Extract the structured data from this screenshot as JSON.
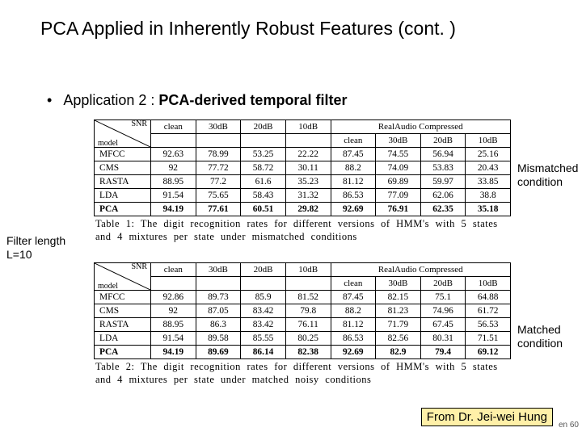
{
  "title": "PCA Applied in Inherently Robust Features (cont. )",
  "bullet": {
    "plain": "Application 2 : ",
    "bold": "PCA-derived temporal filter"
  },
  "annotations": {
    "mismatched": "Mismatched condition",
    "matched": "Matched condition",
    "filterLength": "Filter length L=10"
  },
  "tableHeader": {
    "diagTop": "SNR",
    "diagBottom": "model",
    "group2": "RealAudio Compressed",
    "snrs1": [
      "clean",
      "30dB",
      "20dB",
      "10dB"
    ],
    "snrs2": [
      "clean",
      "30dB",
      "20dB",
      "10dB"
    ]
  },
  "models": [
    "MFCC",
    "CMS",
    "RASTA",
    "LDA",
    "PCA"
  ],
  "chart_data": [
    {
      "type": "table",
      "title": "Table 1: The digit recognition rates for different versions of HMM's with 5 states and 4 mixtures per state under mismatched conditions",
      "row_labels": [
        "MFCC",
        "CMS",
        "RASTA",
        "LDA",
        "PCA"
      ],
      "column_groups": [
        "",
        "RealAudio Compressed"
      ],
      "columns": [
        "clean",
        "30dB",
        "20dB",
        "10dB",
        "clean",
        "30dB",
        "20dB",
        "10dB"
      ],
      "rows": [
        [
          92.63,
          78.99,
          53.25,
          22.22,
          87.45,
          74.55,
          56.94,
          25.16
        ],
        [
          92.0,
          77.72,
          58.72,
          30.11,
          88.2,
          74.09,
          53.83,
          20.43
        ],
        [
          88.95,
          77.2,
          61.6,
          35.23,
          81.12,
          69.89,
          59.97,
          33.85
        ],
        [
          91.54,
          75.65,
          58.43,
          31.32,
          86.53,
          77.09,
          62.06,
          38.8
        ],
        [
          94.19,
          77.61,
          60.51,
          29.82,
          92.69,
          76.91,
          62.35,
          35.18
        ]
      ]
    },
    {
      "type": "table",
      "title": "Table 2: The digit recognition rates for different versions of HMM's with 5 states and 4 mixtures per state under matched noisy conditions",
      "row_labels": [
        "MFCC",
        "CMS",
        "RASTA",
        "LDA",
        "PCA"
      ],
      "column_groups": [
        "",
        "RealAudio Compressed"
      ],
      "columns": [
        "clean",
        "30dB",
        "20dB",
        "10dB",
        "clean",
        "30dB",
        "20dB",
        "10dB"
      ],
      "rows": [
        [
          92.86,
          89.73,
          85.9,
          81.52,
          87.45,
          82.15,
          75.1,
          64.88
        ],
        [
          92.0,
          87.05,
          83.42,
          79.8,
          88.2,
          81.23,
          74.96,
          61.72
        ],
        [
          88.95,
          86.3,
          83.42,
          76.11,
          81.12,
          71.79,
          67.45,
          56.53
        ],
        [
          91.54,
          89.58,
          85.55,
          80.25,
          86.53,
          82.56,
          80.31,
          71.51
        ],
        [
          94.19,
          89.69,
          86.14,
          82.38,
          92.69,
          82.9,
          79.4,
          69.12
        ]
      ]
    }
  ],
  "credit": "From Dr. Jei-wei Hung",
  "tinyRight": "en 60"
}
